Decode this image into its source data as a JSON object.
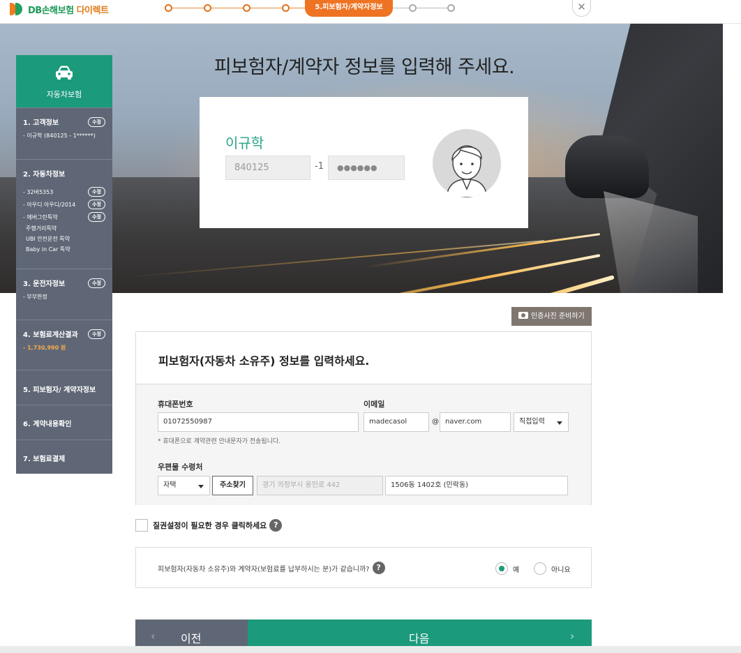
{
  "header": {
    "logo_text": "DB손해보험",
    "logo_direct": "다이렉트",
    "active_step_label": "5.피보험자/계약자정보",
    "close_label": "✕"
  },
  "hero": {
    "title": "피보험자/계약자 정보를 입력해 주세요."
  },
  "id_card": {
    "name": "이규학",
    "birth": "840125",
    "dash": "-1",
    "masked": "●●●●●●"
  },
  "sidebar": {
    "head_label": "자동차보험",
    "customer": {
      "title": "1. 고객정보",
      "modify": "수정",
      "detail": "- 이규학 (840125 - 1******)"
    },
    "car": {
      "title": "2. 자동차정보",
      "rows": [
        {
          "text": "- 32버5353",
          "modify": "수정"
        },
        {
          "text": "- 아우디 아우디/2014",
          "modify": "수정"
        },
        {
          "text": "- 에버그린특약",
          "modify": "수정"
        }
      ],
      "extras": [
        "주행거리특약",
        "UBI 안전운전 특약",
        "Baby in Car 특약"
      ]
    },
    "driver": {
      "title": "3. 운전자정보",
      "modify": "수정",
      "detail": "- 부부한정"
    },
    "premium": {
      "title": "4. 보험료계산결과",
      "modify": "수정",
      "detail": "- 1,730,990 원"
    },
    "insured": {
      "title": "5. 피보험자/ 계약자정보"
    },
    "confirm": {
      "title": "6. 계약내용확인"
    },
    "payment": {
      "title": "7. 보험료결제"
    }
  },
  "photo_button": "인증사진 준비하기",
  "form": {
    "heading": "피보험자(자동차 소유주) 정보를 입력하세요.",
    "phone_label": "휴대폰번호",
    "phone_value": "01072550987",
    "email_label": "이메일",
    "email_id": "madecasol",
    "email_at": "@",
    "email_domain": "naver.com",
    "email_select": "직접입력",
    "phone_note": "* 휴대폰으로 계약관련 안내문자가 전송됩니다.",
    "mail_label": "우편물 수령처",
    "mail_select": "자택",
    "address_button": "주소찾기",
    "address_main": "경기 의정부시 용민로 442",
    "address_detail": "1506동 1402호 (민락동)"
  },
  "pledge": {
    "label": "질권설정이 필요한 경우 클릭하세요",
    "help": "?"
  },
  "same": {
    "question": "피보험자(자동차 소유주)와 계약자(보험료를 납부하시는 분)가 같습니까?",
    "help": "?",
    "yes": "예",
    "no": "아니요",
    "selected": "yes"
  },
  "nav": {
    "prev": "이전",
    "prev_arrow": "‹",
    "next": "다음",
    "next_arrow": "›"
  },
  "colors": {
    "accent": "#1b9a7c",
    "sidebar": "#5f6776",
    "step_orange": "#ee7423"
  }
}
